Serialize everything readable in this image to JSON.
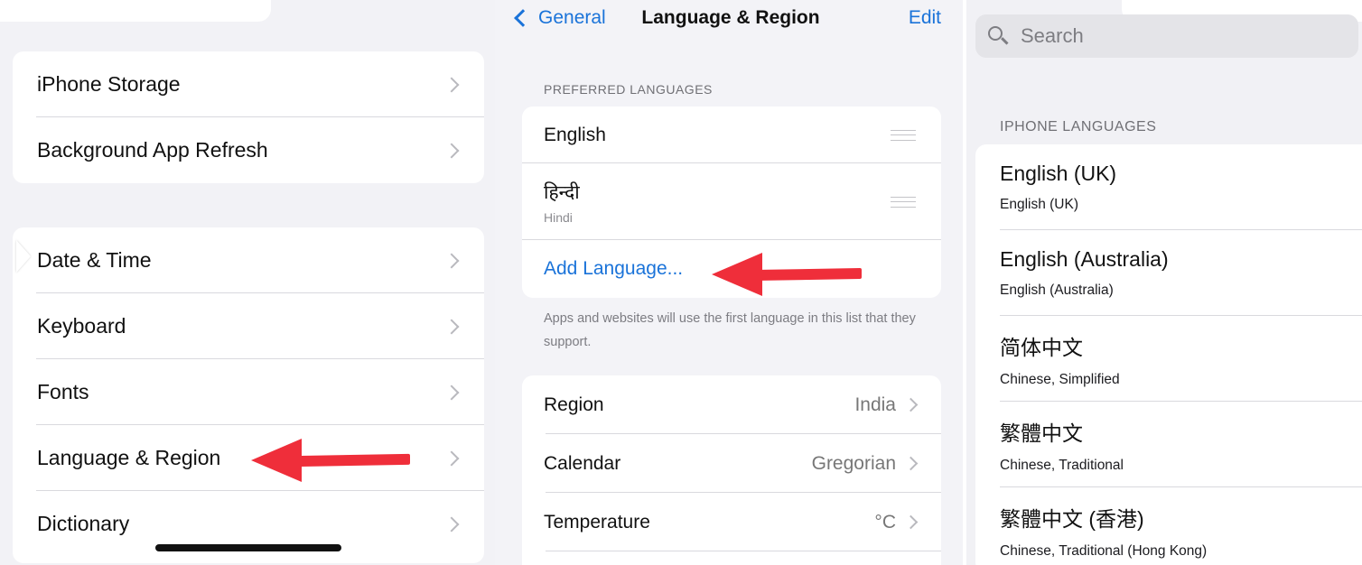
{
  "panel1": {
    "group1": [
      "iPhone Storage",
      "Background App Refresh"
    ],
    "group2": [
      "Date & Time",
      "Keyboard",
      "Fonts",
      "Language & Region",
      "Dictionary"
    ]
  },
  "panel2": {
    "back_label": "General",
    "title": "Language & Region",
    "edit_label": "Edit",
    "preferred_header": "PREFERRED LANGUAGES",
    "languages": [
      {
        "name": "English",
        "sub": ""
      },
      {
        "name": "हिन्दी",
        "sub": "Hindi"
      }
    ],
    "add_language": "Add Language...",
    "footnote": "Apps and websites will use the first language in this list that they support.",
    "settings": [
      {
        "label": "Region",
        "value": "India"
      },
      {
        "label": "Calendar",
        "value": "Gregorian"
      },
      {
        "label": "Temperature",
        "value": "°C"
      }
    ]
  },
  "panel3": {
    "search_placeholder": "Search",
    "section_header": "IPHONE LANGUAGES",
    "languages": [
      {
        "name": "English (UK)",
        "sub": "English (UK)"
      },
      {
        "name": "English (Australia)",
        "sub": "English (Australia)"
      },
      {
        "name": "简体中文",
        "sub": "Chinese, Simplified"
      },
      {
        "name": "繁體中文",
        "sub": "Chinese, Traditional"
      },
      {
        "name": "繁體中文 (香港)",
        "sub": "Chinese, Traditional (Hong Kong)"
      }
    ]
  },
  "colors": {
    "accent": "#1a73d9",
    "annotation_arrow": "#ef2e3a",
    "background": "#f2f2f6"
  }
}
